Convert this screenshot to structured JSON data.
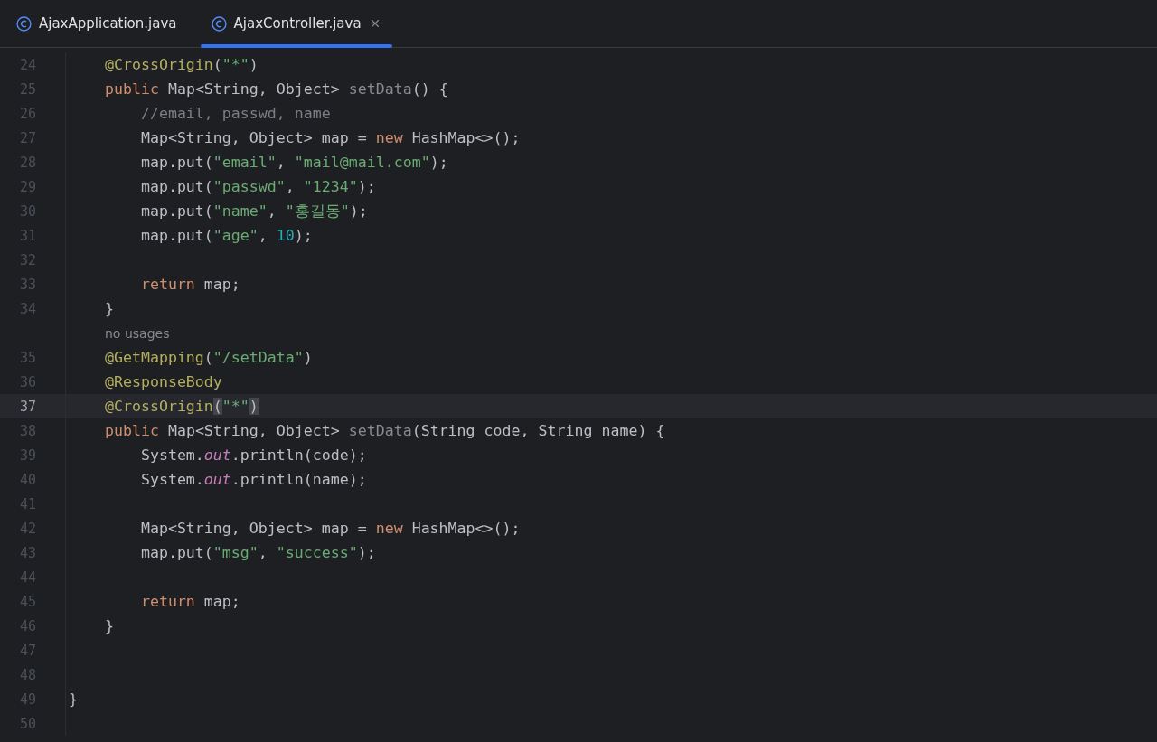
{
  "tabs": [
    {
      "label": "AjaxApplication.java",
      "selected": false,
      "closable": false
    },
    {
      "label": "AjaxController.java",
      "selected": true,
      "closable": true
    }
  ],
  "lines": [
    {
      "kind": "code",
      "number": "24",
      "current": false,
      "tokens": [
        {
          "kind": "ann",
          "text": "    @CrossOrigin"
        },
        {
          "kind": "plain",
          "text": "("
        },
        {
          "kind": "str",
          "text": "\"*\""
        },
        {
          "kind": "plain",
          "text": ")"
        }
      ]
    },
    {
      "kind": "code",
      "number": "25",
      "current": false,
      "tokens": [
        {
          "kind": "kw",
          "text": "    public "
        },
        {
          "kind": "plain",
          "text": "Map<String, Object> "
        },
        {
          "kind": "unused",
          "text": "setData"
        },
        {
          "kind": "plain",
          "text": "() {"
        }
      ]
    },
    {
      "kind": "code",
      "number": "26",
      "current": false,
      "tokens": [
        {
          "kind": "comment",
          "text": "        //email, passwd, name"
        }
      ]
    },
    {
      "kind": "code",
      "number": "27",
      "current": false,
      "tokens": [
        {
          "kind": "plain",
          "text": "        Map<String, Object> map = "
        },
        {
          "kind": "kw",
          "text": "new "
        },
        {
          "kind": "plain",
          "text": "HashMap<>();"
        }
      ]
    },
    {
      "kind": "code",
      "number": "28",
      "current": false,
      "tokens": [
        {
          "kind": "plain",
          "text": "        map.put("
        },
        {
          "kind": "str",
          "text": "\"email\""
        },
        {
          "kind": "plain",
          "text": ", "
        },
        {
          "kind": "str",
          "text": "\"mail@mail.com\""
        },
        {
          "kind": "plain",
          "text": ");"
        }
      ]
    },
    {
      "kind": "code",
      "number": "29",
      "current": false,
      "tokens": [
        {
          "kind": "plain",
          "text": "        map.put("
        },
        {
          "kind": "str",
          "text": "\"passwd\""
        },
        {
          "kind": "plain",
          "text": ", "
        },
        {
          "kind": "str",
          "text": "\"1234\""
        },
        {
          "kind": "plain",
          "text": ");"
        }
      ]
    },
    {
      "kind": "code",
      "number": "30",
      "current": false,
      "tokens": [
        {
          "kind": "plain",
          "text": "        map.put("
        },
        {
          "kind": "str",
          "text": "\"name\""
        },
        {
          "kind": "plain",
          "text": ", "
        },
        {
          "kind": "str",
          "text": "\"홍길동\""
        },
        {
          "kind": "plain",
          "text": ");"
        }
      ]
    },
    {
      "kind": "code",
      "number": "31",
      "current": false,
      "tokens": [
        {
          "kind": "plain",
          "text": "        map.put("
        },
        {
          "kind": "str",
          "text": "\"age\""
        },
        {
          "kind": "plain",
          "text": ", "
        },
        {
          "kind": "num",
          "text": "10"
        },
        {
          "kind": "plain",
          "text": ");"
        }
      ]
    },
    {
      "kind": "code",
      "number": "32",
      "current": false
    },
    {
      "kind": "code",
      "number": "33",
      "current": false,
      "tokens": [
        {
          "kind": "kw",
          "text": "        return "
        },
        {
          "kind": "plain",
          "text": "map;"
        }
      ]
    },
    {
      "kind": "code",
      "number": "34",
      "current": false,
      "tokens": [
        {
          "kind": "plain",
          "text": "    }"
        }
      ]
    },
    {
      "kind": "hint",
      "text": "no usages"
    },
    {
      "kind": "code",
      "number": "35",
      "current": false,
      "tokens": [
        {
          "kind": "ann",
          "text": "    @GetMapping"
        },
        {
          "kind": "plain",
          "text": "("
        },
        {
          "kind": "str",
          "text": "\"/setData\""
        },
        {
          "kind": "plain",
          "text": ")"
        }
      ]
    },
    {
      "kind": "code",
      "number": "36",
      "current": false,
      "tokens": [
        {
          "kind": "ann",
          "text": "    @ResponseBody"
        }
      ]
    },
    {
      "kind": "code",
      "number": "37",
      "current": true,
      "tokens": [
        {
          "kind": "ann",
          "text": "    @CrossOrigin"
        },
        {
          "kind": "match",
          "text": "("
        },
        {
          "kind": "str",
          "text": "\"*\""
        },
        {
          "kind": "match",
          "text": ")"
        }
      ]
    },
    {
      "kind": "code",
      "number": "38",
      "current": false,
      "tokens": [
        {
          "kind": "kw",
          "text": "    public "
        },
        {
          "kind": "plain",
          "text": "Map<String, Object> "
        },
        {
          "kind": "unused",
          "text": "setData"
        },
        {
          "kind": "plain",
          "text": "(String code, String name) {"
        }
      ]
    },
    {
      "kind": "code",
      "number": "39",
      "current": false,
      "tokens": [
        {
          "kind": "plain",
          "text": "        System."
        },
        {
          "kind": "field",
          "text": "out"
        },
        {
          "kind": "plain",
          "text": ".println(code);"
        }
      ]
    },
    {
      "kind": "code",
      "number": "40",
      "current": false,
      "tokens": [
        {
          "kind": "plain",
          "text": "        System."
        },
        {
          "kind": "field",
          "text": "out"
        },
        {
          "kind": "plain",
          "text": ".println(name);"
        }
      ]
    },
    {
      "kind": "code",
      "number": "41",
      "current": false
    },
    {
      "kind": "code",
      "number": "42",
      "current": false,
      "tokens": [
        {
          "kind": "plain",
          "text": "        Map<String, Object> map = "
        },
        {
          "kind": "kw",
          "text": "new "
        },
        {
          "kind": "plain",
          "text": "HashMap<>();"
        }
      ]
    },
    {
      "kind": "code",
      "number": "43",
      "current": false,
      "tokens": [
        {
          "kind": "plain",
          "text": "        map.put("
        },
        {
          "kind": "str",
          "text": "\"msg\""
        },
        {
          "kind": "plain",
          "text": ", "
        },
        {
          "kind": "str",
          "text": "\"success\""
        },
        {
          "kind": "plain",
          "text": ");"
        }
      ]
    },
    {
      "kind": "code",
      "number": "44",
      "current": false
    },
    {
      "kind": "code",
      "number": "45",
      "current": false,
      "tokens": [
        {
          "kind": "kw",
          "text": "        return "
        },
        {
          "kind": "plain",
          "text": "map;"
        }
      ]
    },
    {
      "kind": "code",
      "number": "46",
      "current": false,
      "tokens": [
        {
          "kind": "plain",
          "text": "    }"
        }
      ]
    },
    {
      "kind": "code",
      "number": "47",
      "current": false
    },
    {
      "kind": "code",
      "number": "48",
      "current": false
    },
    {
      "kind": "code",
      "number": "49",
      "current": false,
      "tokens": [
        {
          "kind": "plain",
          "text": "}"
        }
      ]
    },
    {
      "kind": "code",
      "number": "50",
      "current": false
    }
  ]
}
